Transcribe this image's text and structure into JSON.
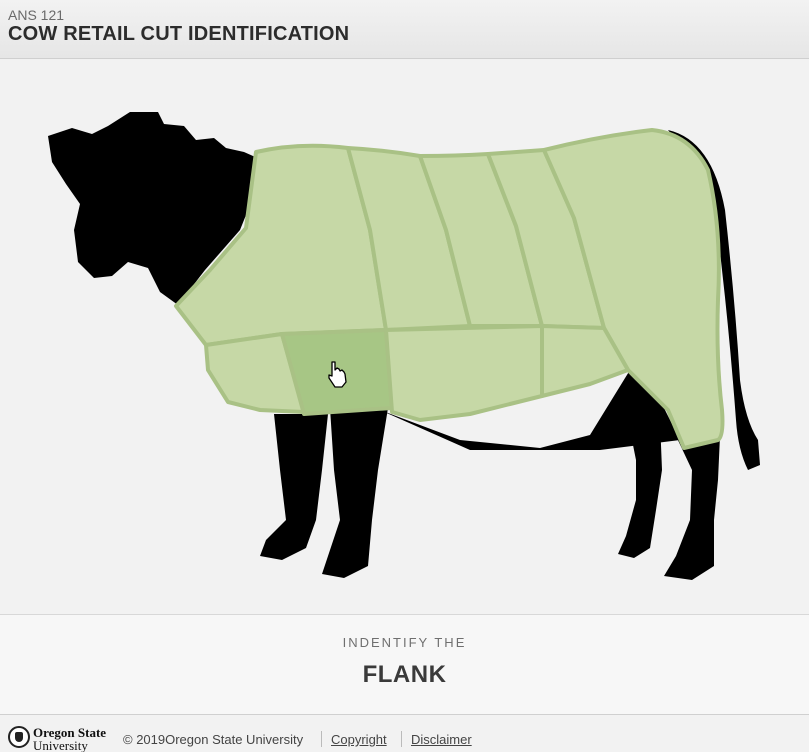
{
  "header": {
    "course": "ANS 121",
    "title": "COW RETAIL CUT IDENTIFICATION"
  },
  "diagram": {
    "cut_fill": "#c6d8a6",
    "cut_active_fill": "#a7c685",
    "cut_stroke": "#a9c185",
    "body_color": "#000000",
    "hovered_cut": "flank",
    "cursor_icon": "hand-pointer-icon"
  },
  "prompt": {
    "label": "INDENTIFY THE",
    "target": "FLANK"
  },
  "footer": {
    "logo_line1": "Oregon State",
    "logo_line2": "University",
    "copyright": "© 2019Oregon State University",
    "link_copyright": "Copyright",
    "link_disclaimer": "Disclaimer"
  }
}
